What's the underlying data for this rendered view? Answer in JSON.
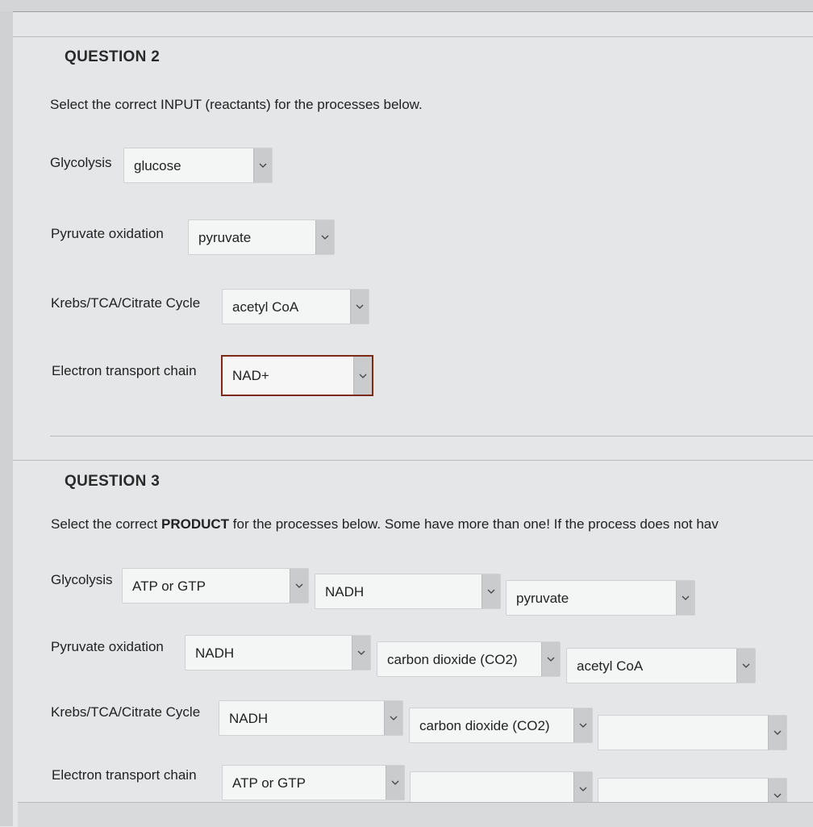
{
  "q2": {
    "title": "QUESTION 2",
    "prompt": "Select the correct INPUT (reactants) for the processes below.",
    "rows": [
      {
        "label": "Glycolysis",
        "selects": [
          "glucose"
        ]
      },
      {
        "label": "Pyruvate oxidation",
        "selects": [
          "pyruvate"
        ]
      },
      {
        "label": "Krebs/TCA/Citrate Cycle",
        "selects": [
          "acetyl CoA"
        ]
      },
      {
        "label": "Electron transport chain",
        "selects": [
          "NAD+"
        ]
      }
    ]
  },
  "q3": {
    "title": "QUESTION 3",
    "prompt_pre": "Select the correct ",
    "prompt_bold": "PRODUCT",
    "prompt_post": " for the processes below. Some have more than one! If the process does not hav",
    "rows": [
      {
        "label": "Glycolysis",
        "selects": [
          "ATP or GTP",
          "NADH",
          "pyruvate"
        ]
      },
      {
        "label": "Pyruvate oxidation",
        "selects": [
          "NADH",
          "carbon dioxide (CO2)",
          "acetyl CoA"
        ]
      },
      {
        "label": "Krebs/TCA/Citrate Cycle",
        "selects": [
          "NADH",
          "carbon dioxide (CO2)",
          ""
        ]
      },
      {
        "label": "Electron transport chain",
        "selects": [
          "ATP or GTP",
          "",
          ""
        ]
      }
    ]
  },
  "icons": {
    "dropdown": "chevron-down-icon"
  },
  "colors": {
    "active_border": "#7a2a16",
    "background": "#e4e6e7"
  }
}
